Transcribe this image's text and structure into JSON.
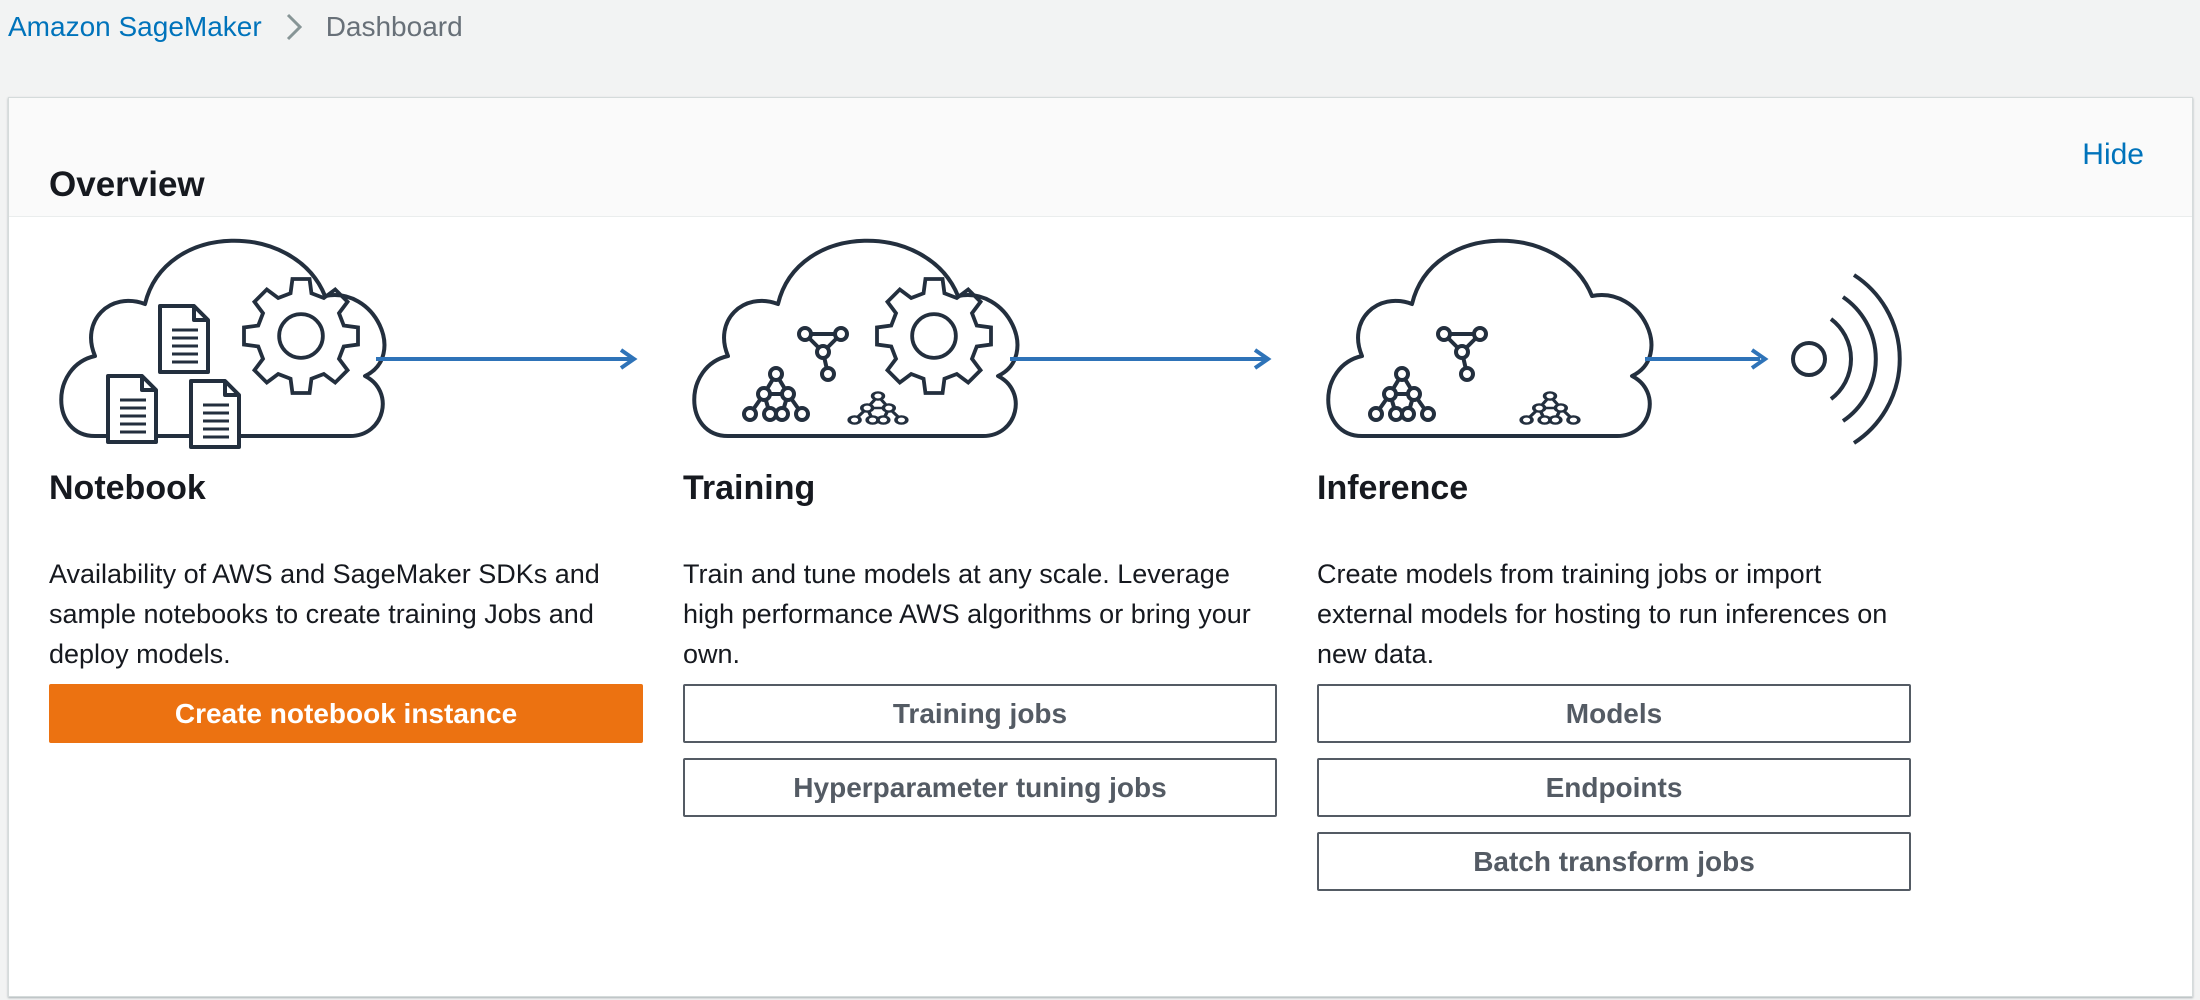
{
  "breadcrumb": {
    "root": "Amazon SageMaker",
    "current": "Dashboard"
  },
  "overview": {
    "title": "Overview",
    "hide_label": "Hide"
  },
  "columns": [
    {
      "title": "Notebook",
      "description": "Availability of AWS and SageMaker SDKs and sample notebooks to create training Jobs and deploy models.",
      "buttons": [
        "Create notebook instance"
      ]
    },
    {
      "title": "Training",
      "description": "Train and tune models at any scale. Leverage high performance AWS algorithms or bring your own.",
      "buttons": [
        "Training jobs",
        "Hyperparameter tuning jobs"
      ]
    },
    {
      "title": "Inference",
      "description": "Create models from training jobs or import external models for hosting to run inferences on new data.",
      "buttons": [
        "Models",
        "Endpoints",
        "Batch transform jobs"
      ]
    }
  ],
  "colors": {
    "link": "#0073bb",
    "primary_button": "#ec7211",
    "arrow": "#2e73b8",
    "icon_stroke": "#232f3e"
  },
  "icons": {
    "notebook": "cloud-documents-gear-icon",
    "training": "cloud-network-gear-icon",
    "inference": "cloud-network-icon",
    "endpoint": "broadcast-signal-icon"
  }
}
